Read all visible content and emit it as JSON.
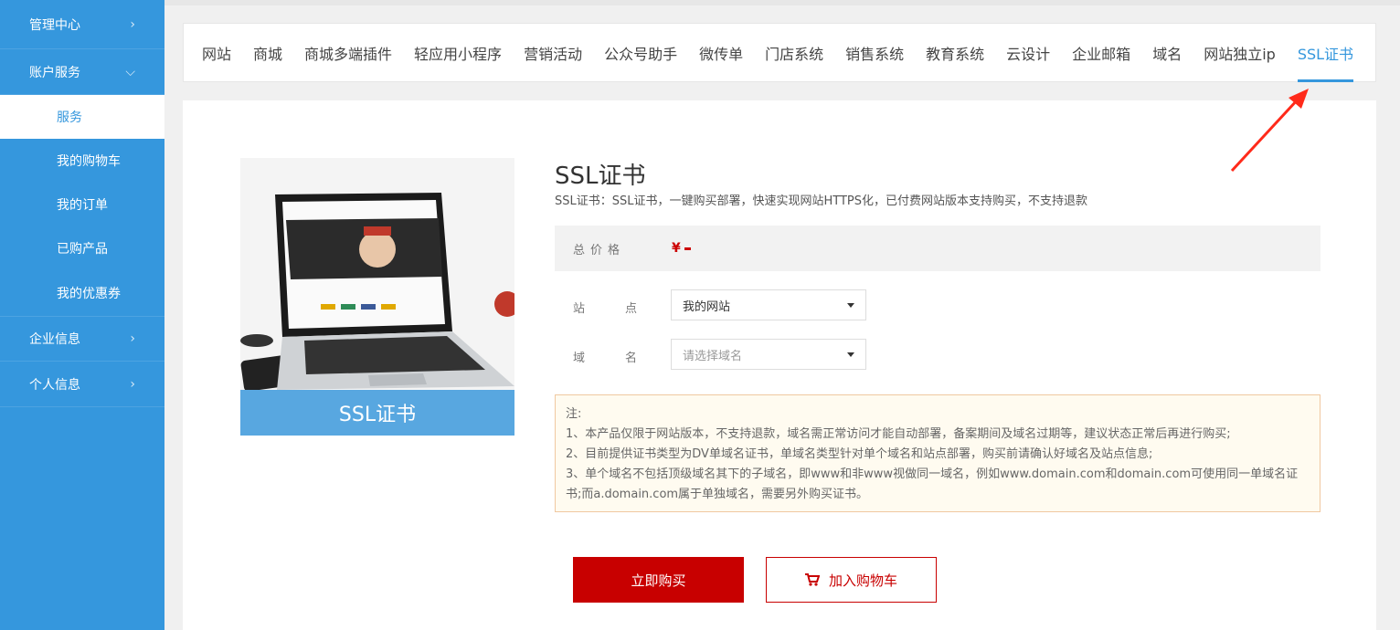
{
  "sidebar": {
    "management_center": "管理中心",
    "account_service": "账户服务",
    "sub_items": [
      {
        "label": "服务"
      },
      {
        "label": "我的购物车"
      },
      {
        "label": "我的订单"
      },
      {
        "label": "已购产品"
      },
      {
        "label": "我的优惠券"
      }
    ],
    "company_info": "企业信息",
    "personal_info": "个人信息"
  },
  "nav": {
    "items": [
      {
        "label": "网站"
      },
      {
        "label": "商城"
      },
      {
        "label": "商城多端插件"
      },
      {
        "label": "轻应用小程序"
      },
      {
        "label": "营销活动"
      },
      {
        "label": "公众号助手"
      },
      {
        "label": "微传单"
      },
      {
        "label": "门店系统"
      },
      {
        "label": "销售系统"
      },
      {
        "label": "教育系统"
      },
      {
        "label": "云设计"
      },
      {
        "label": "企业邮箱"
      },
      {
        "label": "域名"
      },
      {
        "label": "网站独立ip"
      },
      {
        "label": "SSL证书"
      }
    ],
    "active": "SSL证书"
  },
  "product": {
    "image_caption": "SSL证书",
    "title": "SSL证书",
    "description": "SSL证书：SSL证书，一键购买部署，快速实现网站HTTPS化，已付费网站版本支持购买，不支持退款",
    "price_label": "总价格",
    "price_symbol": "¥",
    "site_label_a": "站",
    "site_label_b": "点",
    "site_value": "我的网站",
    "domain_label_a": "域",
    "domain_label_b": "名",
    "domain_placeholder": "请选择域名",
    "note_title": "注:",
    "note_lines": [
      "1、本产品仅限于网站版本，不支持退款，域名需正常访问才能自动部署，备案期间及域名过期等，建议状态正常后再进行购买;",
      "2、目前提供证书类型为DV单域名证书，单域名类型针对单个域名和站点部署，购买前请确认好域名及站点信息;",
      "3、单个域名不包括顶级域名其下的子域名，即www和非www视做同一域名，例如www.domain.com和domain.com可使用同一单域名证书;而a.domain.com属于单独域名，需要另外购买证书。"
    ],
    "buy_now": "立即购买",
    "add_to_cart": "加入购物车"
  },
  "colors": {
    "sidebar": "#3597dd",
    "accent": "#3597dd",
    "buy_button": "#c80000",
    "arrow": "#ff2a1a"
  }
}
